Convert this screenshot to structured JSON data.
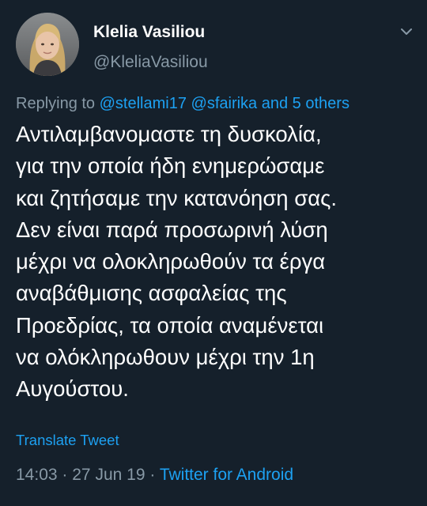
{
  "author": {
    "display_name": "Klelia Vasiliou",
    "handle": "@KleliaVasiliou"
  },
  "reply_context": {
    "prefix": "Replying to",
    "mention_1": "@stellami17",
    "mention_2": "@sfairika",
    "others": "and 5 others"
  },
  "tweet": {
    "text": "Αντιλαμβανομαστε τη δυσκολία,\nγια την οποία ήδη ενημερώσαμε\nκαι ζητήσαμε την κατανόηση σας.\nΔεν είναι παρά προσωρινή λύση\nμέχρι να ολοκληρωθούν τα έργα\nαναβάθμισης ασφαλείας της\nΠροεδρίας, τα οποία αναμένεται\nνα ολόκληρωθουν μέχρι την 1η\nΑυγούστου.",
    "translate_label": "Translate Tweet"
  },
  "meta": {
    "time": "14:03",
    "separator": "·",
    "date": "27 Jun 19",
    "source": "Twitter for Android"
  },
  "icons": {
    "menu": "chevron-down-icon"
  },
  "colors": {
    "background": "#15202b",
    "text_primary": "#ffffff",
    "text_secondary": "#8899a6",
    "accent": "#1da1f2"
  }
}
